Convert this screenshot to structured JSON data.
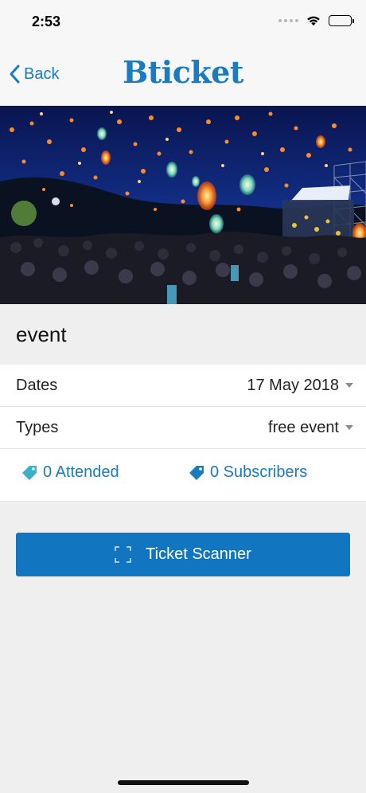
{
  "status_bar": {
    "time": "2:53",
    "icons": [
      "cellular-signal-icon",
      "wifi-icon",
      "battery-icon"
    ]
  },
  "nav": {
    "back_label": "Back",
    "brand": "Bticket"
  },
  "hero": {
    "icon": "event-photo-sky-lanterns"
  },
  "event": {
    "title": "event"
  },
  "details": {
    "dates_label": "Dates",
    "dates_value": "17 May 2018",
    "types_label": "Types",
    "types_value": "free event"
  },
  "stats": {
    "attended": "0 Attended",
    "subscribers": "0 Subscribers",
    "attended_icon_color": "#3ab0c9",
    "subscribers_icon_color": "#1a7bc1"
  },
  "actions": {
    "scanner_label": "Ticket Scanner"
  },
  "colors": {
    "accent": "#1a7bc1",
    "button": "#1275bf",
    "background": "#efefef"
  }
}
